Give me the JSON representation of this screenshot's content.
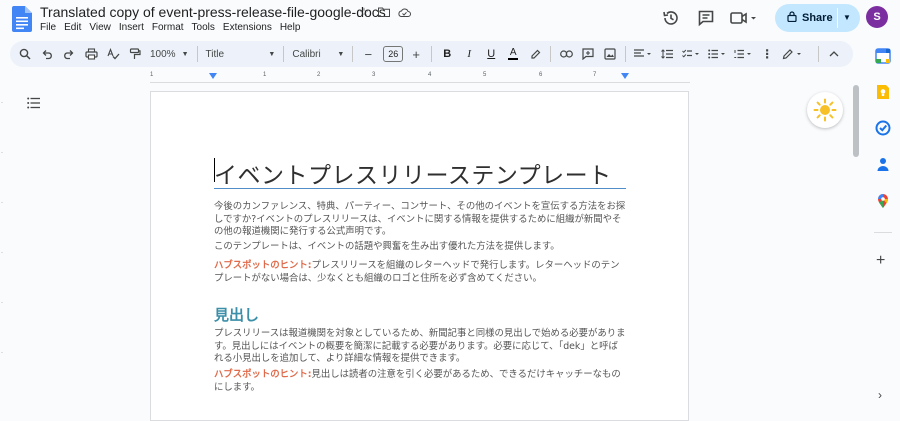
{
  "doc": {
    "title": "Translated copy of event-press-release-file-google-docs",
    "menu": [
      "File",
      "Edit",
      "View",
      "Insert",
      "Format",
      "Tools",
      "Extensions",
      "Help"
    ]
  },
  "header": {
    "share_label": "Share",
    "avatar_letter": "S"
  },
  "toolbar": {
    "zoom": "100%",
    "style": "Title",
    "font": "Calibri",
    "font_size": "26"
  },
  "ruler": {
    "labels": [
      "1",
      "1",
      "2",
      "3",
      "4",
      "5",
      "6",
      "7"
    ]
  },
  "content": {
    "title": "イベントプレスリリーステンプレート",
    "para1": "今後のカンファレンス、特典、パーティー、コンサート、その他のイベントを宣伝する方法をお探しですか?イベントのプレスリリースは、イベントに関する情報を提供するために組織が新聞やその他の報道機関に発行する公式声明です。",
    "para2": "このテンプレートは、イベントの話題や興奮を生み出す優れた方法を提供します。",
    "tip1_label": "ハブスポットのヒント:",
    "tip1_text": "プレスリリースを組織のレターヘッドで発行します。レターヘッドのテンプレートがない場合は、少なくとも組織のロゴと住所を必ず含めてください。",
    "heading": "見出し",
    "para3": "プレスリリースは報道機関を対象としているため、新聞記事と同様の見出しで始める必要があります。見出しにはイベントの概要を簡潔に記載する必要があります。必要に応じて、「dek」と呼ばれる小見出しを追加して、より詳細な情報を提供できます。",
    "tip2_label": "ハブスポットのヒント:",
    "tip2_text": "見出しは読者の注意を引く必要があるため、できるだけキャッチーなものにします。"
  },
  "colors": {
    "accent": "#c2e7ff",
    "tip": "#e06a4a",
    "heading": "#3c8fa8",
    "avatar": "#7b2ea0"
  }
}
